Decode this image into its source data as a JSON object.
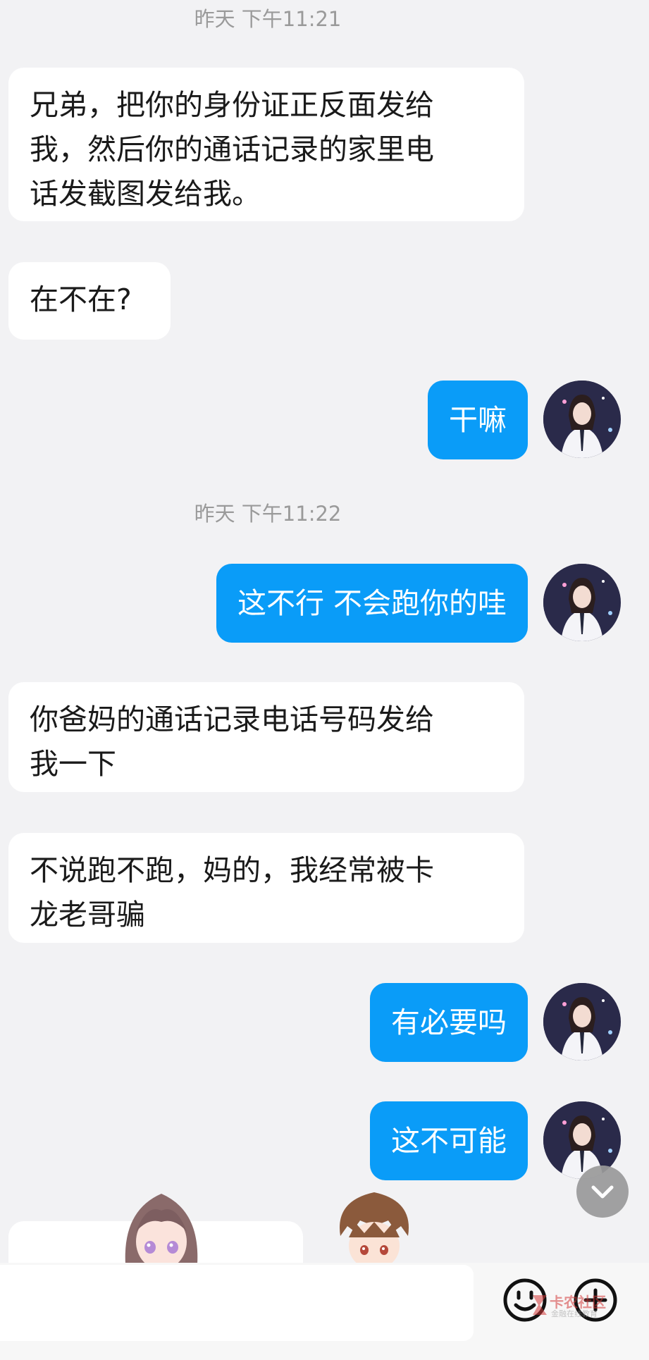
{
  "messages": [
    {
      "type": "timestamp",
      "text": "昨天 下午11:21"
    },
    {
      "type": "incoming",
      "lines": [
        "兄弟，把你的身份证正反面发给",
        "我，然后你的通话记录的家里电",
        "话发截图发给我。"
      ]
    },
    {
      "type": "incoming",
      "lines": [
        "在不在?"
      ]
    },
    {
      "type": "outgoing",
      "text": "干嘛"
    },
    {
      "type": "timestamp",
      "text": "昨天 下午11:22"
    },
    {
      "type": "outgoing",
      "text": "这不行 不会跑你的哇"
    },
    {
      "type": "incoming",
      "lines": [
        "你爸妈的通话记录电话号码发给",
        "我一下"
      ]
    },
    {
      "type": "incoming",
      "lines": [
        "不说跑不跑，妈的，我经常被卡",
        "龙老哥骗"
      ]
    },
    {
      "type": "outgoing",
      "text": "有必要吗"
    },
    {
      "type": "outgoing",
      "text": "这不可能"
    }
  ],
  "colors": {
    "background": "#f2f2f4",
    "incoming_bubble": "#ffffff",
    "outgoing_bubble": "#0a9cf8",
    "timestamp_text": "#9a9a9a"
  },
  "icons": {
    "scroll_down": "chevron-down-icon",
    "emoji": "emoji-icon",
    "more": "plus-circle-icon"
  },
  "watermark": {
    "main": "卡农社区",
    "sub": "金融在线教育"
  }
}
